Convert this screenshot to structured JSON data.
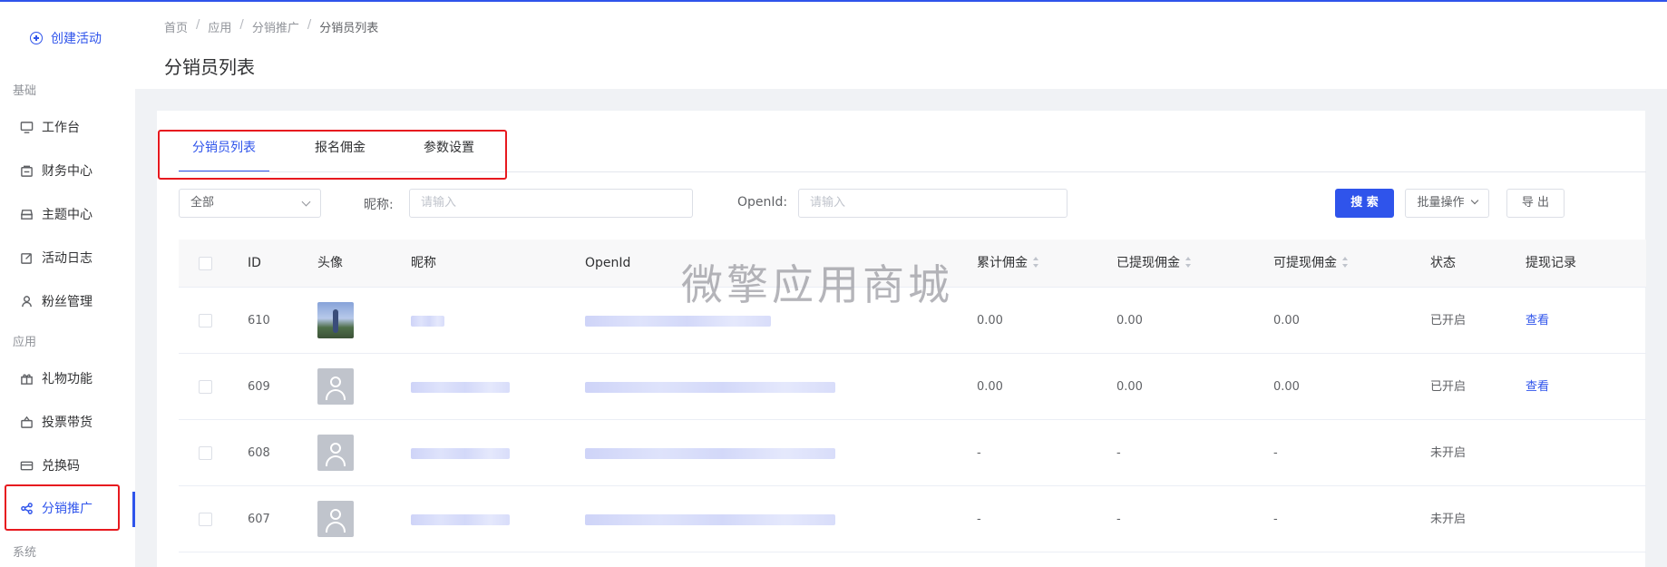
{
  "sidebar": {
    "create_label": "创建活动",
    "groups": [
      {
        "label": "基础"
      },
      {
        "label": "应用"
      },
      {
        "label": "系统"
      }
    ],
    "items": [
      {
        "label": "工作台",
        "icon": "monitor-icon"
      },
      {
        "label": "财务中心",
        "icon": "wallet-icon"
      },
      {
        "label": "主题中心",
        "icon": "theme-icon"
      },
      {
        "label": "活动日志",
        "icon": "edit-icon"
      },
      {
        "label": "粉丝管理",
        "icon": "user-icon"
      },
      {
        "label": "礼物功能",
        "icon": "gift-icon"
      },
      {
        "label": "投票带货",
        "icon": "vote-icon"
      },
      {
        "label": "兑换码",
        "icon": "card-icon"
      },
      {
        "label": "分销推广",
        "icon": "share-icon",
        "active": true
      }
    ]
  },
  "header": {
    "breadcrumb": [
      "首页",
      "应用",
      "分销推广",
      "分销员列表"
    ],
    "separator": "/",
    "title": "分销员列表"
  },
  "tabs": [
    "分销员列表",
    "报名佣金",
    "参数设置"
  ],
  "filters": {
    "status_select": "全部",
    "nickname_label": "昵称:",
    "nickname_placeholder": "请输入",
    "openid_label": "OpenId:",
    "openid_placeholder": "请输入",
    "search_button": "搜 索",
    "batch_button": "批量操作",
    "export_button": "导 出"
  },
  "table": {
    "columns": [
      "ID",
      "头像",
      "昵称",
      "OpenId",
      "累计佣金",
      "已提现佣金",
      "可提现佣金",
      "状态",
      "提现记录"
    ],
    "rows": [
      {
        "id": "610",
        "avatar": "photo",
        "total": "0.00",
        "withdrawn": "0.00",
        "available": "0.00",
        "status": "已开启",
        "record": "查看"
      },
      {
        "id": "609",
        "avatar": "default",
        "total": "0.00",
        "withdrawn": "0.00",
        "available": "0.00",
        "status": "已开启",
        "record": "查看"
      },
      {
        "id": "608",
        "avatar": "default",
        "total": "-",
        "withdrawn": "-",
        "available": "-",
        "status": "未开启",
        "record": ""
      },
      {
        "id": "607",
        "avatar": "default",
        "total": "-",
        "withdrawn": "-",
        "available": "-",
        "status": "未开启",
        "record": ""
      }
    ]
  },
  "watermark": "微擎应用商城",
  "colors": {
    "accent": "#2f54eb",
    "highlight": "#e7191f"
  }
}
